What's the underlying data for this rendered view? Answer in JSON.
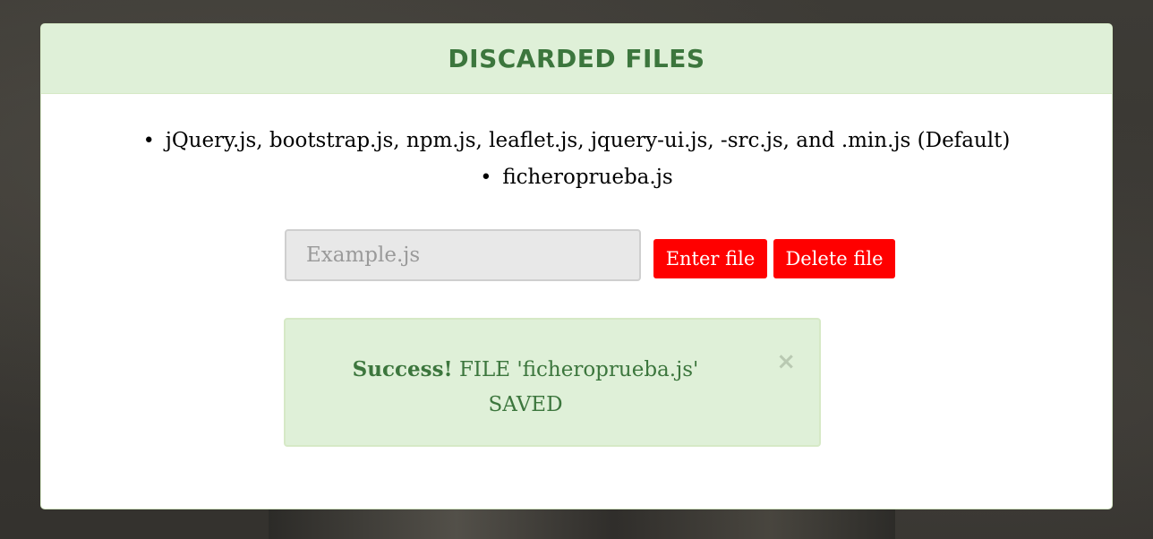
{
  "panel": {
    "title": "DISCARDED FILES"
  },
  "files": {
    "items": [
      "jQuery.js, bootstrap.js, npm.js, leaflet.js, jquery-ui.js, -src.js, and .min.js (Default)",
      "ficheroprueba.js"
    ]
  },
  "form": {
    "placeholder": "Example.js",
    "enter_label": "Enter file",
    "delete_label": "Delete file"
  },
  "alert": {
    "strong": "Success!",
    "message": "FILE 'ficheroprueba.js' SAVED",
    "close_icon": "close-icon",
    "close_symbol": "×"
  },
  "colors": {
    "panel_heading_bg": "#dff0d8",
    "panel_heading_text": "#3c763d",
    "button_bg": "#ff0000",
    "alert_bg": "#dff0d8",
    "alert_text": "#3c763d"
  }
}
